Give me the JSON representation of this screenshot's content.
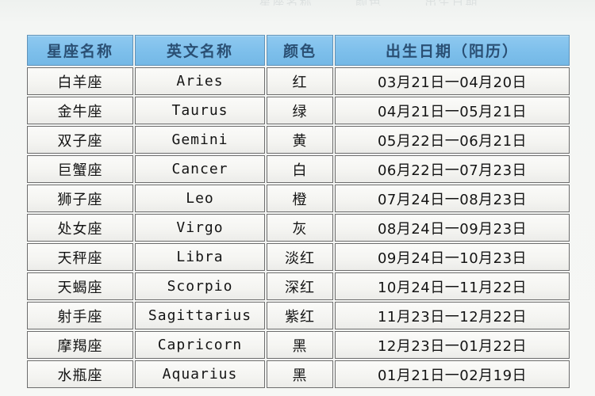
{
  "top_sliver": {
    "fragments": [
      "星座名称",
      "颜色",
      "出生日期"
    ]
  },
  "table": {
    "headers": [
      "星座名称",
      "英文名称",
      "颜色",
      "出生日期（阳历）"
    ],
    "header_background": "#7dbfeb",
    "header_text_color": "#2a4f73",
    "cell_background": "#f4f4f1",
    "rows": [
      {
        "name": "白羊座",
        "english": "Aries",
        "color": "红",
        "dates": "03月21日一04月20日"
      },
      {
        "name": "金牛座",
        "english": "Taurus",
        "color": "绿",
        "dates": "04月21日一05月21日"
      },
      {
        "name": "双子座",
        "english": "Gemini",
        "color": "黄",
        "dates": "05月22日一06月21日"
      },
      {
        "name": "巨蟹座",
        "english": "Cancer",
        "color": "白",
        "dates": "06月22日一07月23日"
      },
      {
        "name": "狮子座",
        "english": "Leo",
        "color": "橙",
        "dates": "07月24日一08月23日"
      },
      {
        "name": "处女座",
        "english": "Virgo",
        "color": "灰",
        "dates": "08月24日一09月23日"
      },
      {
        "name": "天秤座",
        "english": "Libra",
        "color": "淡红",
        "dates": "09月24日一10月23日"
      },
      {
        "name": "天蝎座",
        "english": "Scorpio",
        "color": "深红",
        "dates": "10月24日一11月22日"
      },
      {
        "name": "射手座",
        "english": "Sagittarius",
        "color": "紫红",
        "dates": "11月23日一12月22日"
      },
      {
        "name": "摩羯座",
        "english": "Capricorn",
        "color": "黑",
        "dates": "12月23日一01月22日"
      },
      {
        "name": "水瓶座",
        "english": "Aquarius",
        "color": "黑",
        "dates": "01月21日一02月19日"
      }
    ]
  }
}
